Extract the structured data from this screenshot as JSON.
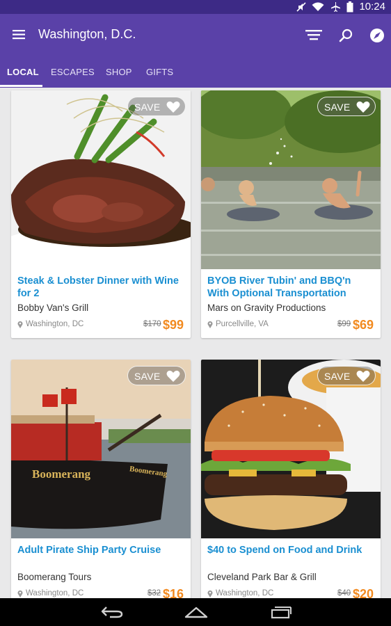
{
  "status_bar": {
    "time": "10:24",
    "icons": [
      "mute-icon",
      "wifi-icon",
      "airplane-icon",
      "battery-icon"
    ]
  },
  "app_bar": {
    "city": "Washington, D.C.",
    "icons": [
      "menu-icon",
      "filter-icon",
      "search-icon",
      "compass-icon"
    ]
  },
  "tabs": [
    {
      "label": "LOCAL",
      "active": true
    },
    {
      "label": "ESCAPES",
      "active": false
    },
    {
      "label": "SHOP",
      "active": false
    },
    {
      "label": "GIFTS",
      "active": false
    }
  ],
  "deals": [
    {
      "save_label": "SAVE",
      "title": "Steak & Lobster Dinner with Wine for 2",
      "merchant": "Bobby Van's Grill",
      "location": "Washington, DC",
      "old_price": "$170",
      "price": "$99"
    },
    {
      "save_label": "SAVE",
      "title": "BYOB River Tubin' and BBQ'n With Optional Transportation",
      "merchant": "Mars on Gravity Productions",
      "location": "Purcellville, VA",
      "old_price": "$99",
      "price": "$69"
    },
    {
      "save_label": "SAVE",
      "title": "Adult Pirate Ship Party Cruise",
      "merchant": "Boomerang Tours",
      "location": "Washington, DC",
      "old_price": "$32",
      "price": "$16",
      "image_text": [
        "Boomerang",
        "Boomerang"
      ]
    },
    {
      "save_label": "SAVE",
      "title": "$40 to Spend on Food and Drink",
      "merchant": "Cleveland Park Bar & Grill",
      "location": "Washington, DC",
      "old_price": "$40",
      "price": "$20"
    }
  ],
  "colors": {
    "primary": "#5a41a8",
    "status_bar": "#3d2a86",
    "title_link": "#1a8fd1",
    "price": "#f28a1f"
  },
  "nav_bar": {
    "icons": [
      "back-icon",
      "home-icon",
      "recents-icon"
    ]
  }
}
